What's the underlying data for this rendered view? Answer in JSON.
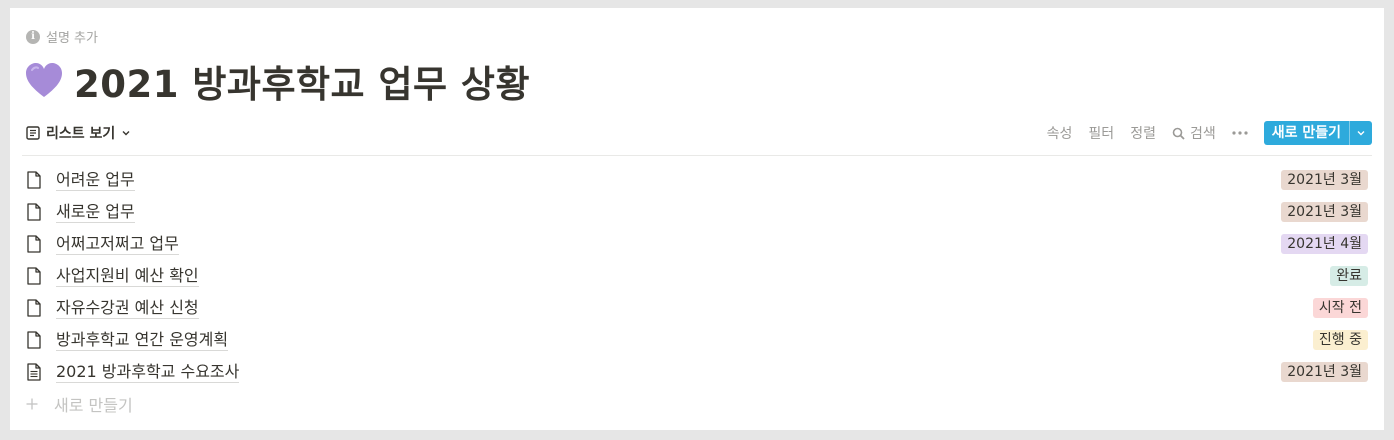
{
  "page": {
    "description": "설명 추가",
    "title": "2021 방과후학교 업무 상황",
    "icon": "purple-heart-icon"
  },
  "toolbar": {
    "view_label": "리스트 보기",
    "properties": "속성",
    "filter": "필터",
    "sort": "정렬",
    "search": "검색",
    "new_button": "새로 만들기"
  },
  "rows": [
    {
      "title": "어려운 업무",
      "tag": "2021년 3월",
      "tag_color": "#e9d8cf",
      "icon": "page-icon"
    },
    {
      "title": "새로운 업무",
      "tag": "2021년 3월",
      "tag_color": "#e9d8cf",
      "icon": "page-icon"
    },
    {
      "title": "어쩌고저쩌고 업무",
      "tag": "2021년 4월",
      "tag_color": "#e4d8f2",
      "icon": "page-icon"
    },
    {
      "title": "사업지원비 예산 확인",
      "tag": "완료",
      "tag_color": "#d6ece6",
      "icon": "page-icon"
    },
    {
      "title": "자유수강권 예산 신청",
      "tag": "시작 전",
      "tag_color": "#fbd7d7",
      "icon": "page-icon"
    },
    {
      "title": "방과후학교 연간 운영계획",
      "tag": "진행 중",
      "tag_color": "#fbefd0",
      "icon": "page-icon"
    },
    {
      "title": "2021 방과후학교 수요조사",
      "tag": "2021년 3월",
      "tag_color": "#e9d8cf",
      "icon": "page-text-icon"
    }
  ],
  "new_row_label": "새로 만들기",
  "colors": {
    "accent": "#2eaadc",
    "heart": "#a68bd8"
  }
}
